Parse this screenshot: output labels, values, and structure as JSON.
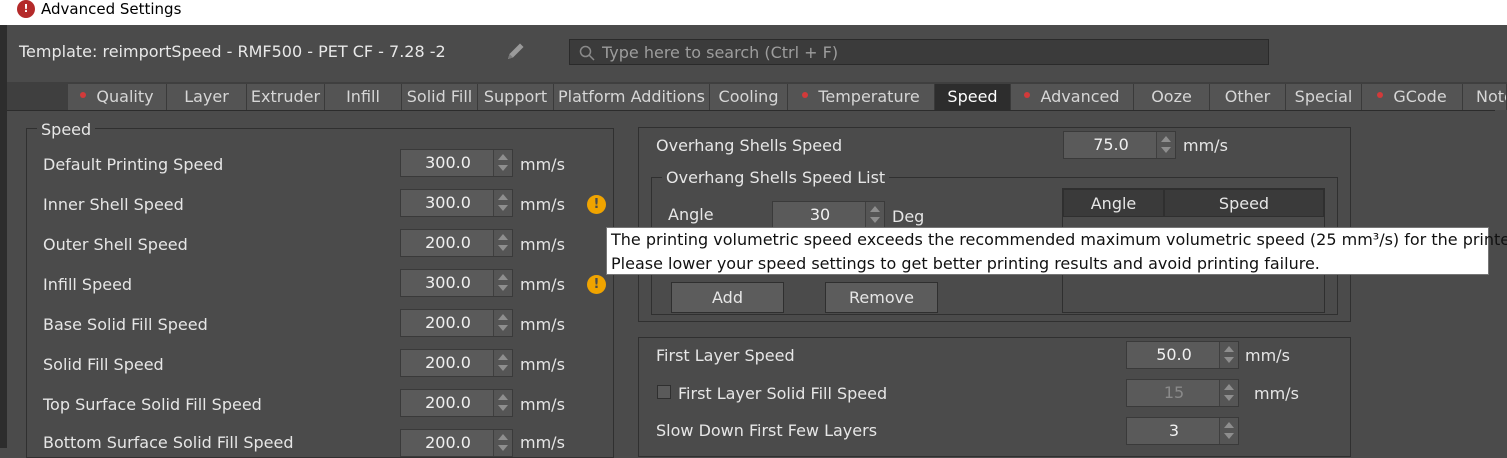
{
  "window": {
    "title": "Advanced Settings",
    "icon": "app-icon"
  },
  "header": {
    "template": "Template: reimportSpeed - RMF500 - PET CF - 7.28 -2",
    "edit_icon": "pencil-icon",
    "search_placeholder": "Type here to search (Ctrl + F)",
    "search_icon": "search-icon"
  },
  "tabs": [
    {
      "label": "Quality",
      "dot": true
    },
    {
      "label": "Layer",
      "dot": false
    },
    {
      "label": "Extruder",
      "dot": false
    },
    {
      "label": "Infill",
      "dot": false
    },
    {
      "label": "Solid Fill",
      "dot": false
    },
    {
      "label": "Support",
      "dot": false
    },
    {
      "label": "Platform Additions",
      "dot": false
    },
    {
      "label": "Cooling",
      "dot": false
    },
    {
      "label": "Temperature",
      "dot": true
    },
    {
      "label": "Speed",
      "dot": false,
      "active": true
    },
    {
      "label": "Advanced",
      "dot": true
    },
    {
      "label": "Ooze",
      "dot": false
    },
    {
      "label": "Other",
      "dot": false
    },
    {
      "label": "Special",
      "dot": false
    },
    {
      "label": "GCode",
      "dot": true
    },
    {
      "label": "Note",
      "dot": false
    }
  ],
  "speed_panel": {
    "title": "Speed",
    "rows": [
      {
        "label": "Default Printing Speed",
        "value": "300.0",
        "unit": "mm/s",
        "warning": false
      },
      {
        "label": "Inner Shell Speed",
        "value": "300.0",
        "unit": "mm/s",
        "warning": true
      },
      {
        "label": "Outer Shell Speed",
        "value": "200.0",
        "unit": "mm/s",
        "warning": false
      },
      {
        "label": "Infill Speed",
        "value": "300.0",
        "unit": "mm/s",
        "warning": true
      },
      {
        "label": "Base Solid Fill Speed",
        "value": "200.0",
        "unit": "mm/s",
        "warning": false
      },
      {
        "label": "Solid Fill Speed",
        "value": "200.0",
        "unit": "mm/s",
        "warning": false
      },
      {
        "label": "Top Surface Solid Fill Speed",
        "value": "200.0",
        "unit": "mm/s",
        "warning": false
      },
      {
        "label": "Bottom Surface Solid Fill Speed",
        "value": "200.0",
        "unit": "mm/s",
        "warning": false
      }
    ],
    "warning_glyph": "!"
  },
  "overhang": {
    "label": "Overhang Shells Speed",
    "value": "75.0",
    "unit": "mm/s",
    "list_title": "Overhang Shells Speed List",
    "angle_label": "Angle",
    "angle_value": "30",
    "angle_unit": "Deg",
    "table_headers": [
      "Angle",
      "Speed"
    ],
    "add_label": "Add",
    "remove_label": "Remove"
  },
  "first_layer": {
    "speed_label": "First Layer Speed",
    "speed_value": "50.0",
    "speed_unit": "mm/s",
    "solid_fill_label": "First Layer Solid Fill Speed",
    "solid_fill_checked": false,
    "solid_fill_value": "15",
    "solid_fill_unit": "mm/s",
    "slow_down_label": "Slow Down First Few Layers",
    "slow_down_value": "3"
  },
  "tooltip": {
    "line1": "The printing volumetric speed exceeds the recommended maximum volumetric speed (25 mm³/s) for the printer.",
    "line2": "Please lower your speed settings to get better printing results and avoid printing failure."
  },
  "colors": {
    "warning": "#f0a400",
    "tab_dot": "#d23a3a",
    "active_tab": "#2d2d2d"
  }
}
